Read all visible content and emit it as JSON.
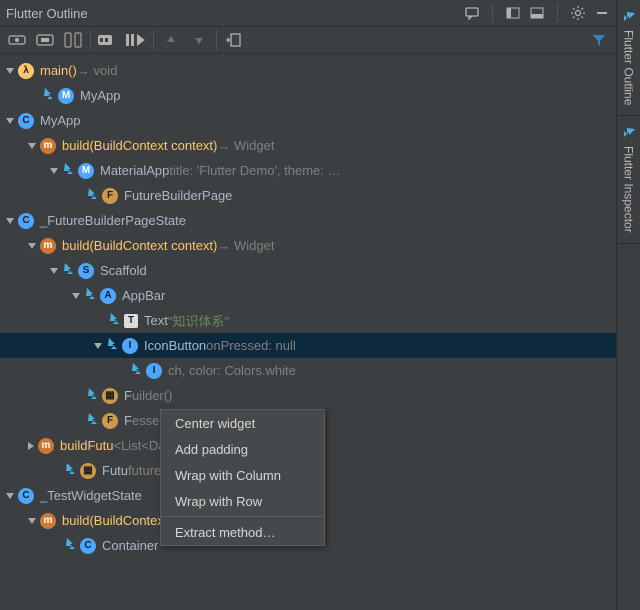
{
  "header": {
    "title": "Flutter Outline"
  },
  "sideTabs": {
    "outline": "Flutter Outline",
    "inspector": "Flutter Inspector"
  },
  "tree": [
    {
      "indent": 0,
      "arrow": "down",
      "flutter": false,
      "badge": "lam",
      "badgeText": "λ",
      "text": "main()",
      "suffix": " → void"
    },
    {
      "indent": 1,
      "arrow": "none",
      "flutter": true,
      "badge": "M",
      "badgeText": "M",
      "text": "MyApp"
    },
    {
      "indent": 0,
      "arrow": "down",
      "flutter": false,
      "badge": "c",
      "badgeText": "C",
      "text": "MyApp"
    },
    {
      "indent": 1,
      "arrow": "down",
      "flutter": false,
      "badge": "m",
      "badgeText": "m",
      "text": "build(BuildContext context)",
      "suffix": " → Widget"
    },
    {
      "indent": 2,
      "arrow": "down",
      "flutter": true,
      "badge": "M",
      "badgeText": "M",
      "text": "MaterialApp",
      "detail": " title: 'Flutter Demo', theme: …"
    },
    {
      "indent": 3,
      "arrow": "none",
      "flutter": true,
      "badge": "f",
      "badgeText": "F",
      "text": "FutureBuilderPage"
    },
    {
      "indent": 0,
      "arrow": "down",
      "flutter": false,
      "badge": "c",
      "badgeText": "C",
      "text": "_FutureBuilderPageState"
    },
    {
      "indent": 1,
      "arrow": "down",
      "flutter": false,
      "badge": "m",
      "badgeText": "m",
      "text": "build(BuildContext context)",
      "suffix": " → Widget"
    },
    {
      "indent": 2,
      "arrow": "down",
      "flutter": true,
      "badge": "s",
      "badgeText": "S",
      "text": "Scaffold"
    },
    {
      "indent": 3,
      "arrow": "down",
      "flutter": true,
      "badge": "a",
      "badgeText": "A",
      "text": "AppBar"
    },
    {
      "indent": 4,
      "arrow": "none",
      "flutter": true,
      "badge": "t",
      "badgeText": "T",
      "text": "Text",
      "string": " \"知识体系\""
    },
    {
      "indent": 4,
      "arrow": "down",
      "flutter": true,
      "badge": "c",
      "badgeText": "I",
      "text": "IconButton",
      "detail": " onPressed: null",
      "selected": true
    },
    {
      "indent": 5,
      "arrow": "none",
      "flutter": true,
      "badge": "c",
      "badgeText": "I",
      "text": "",
      "detail": "ch, color: Colors.white",
      "partial": true
    },
    {
      "indent": 3,
      "arrow": "none",
      "flutter": true,
      "badge": "struct",
      "badgeText": "▦",
      "text": "F",
      "detail": "uilder()",
      "partial": true
    },
    {
      "indent": 3,
      "arrow": "none",
      "flutter": true,
      "badge": "f",
      "badgeText": "F",
      "text": "F",
      "detail": "essed: () { … }",
      "partial": true
    },
    {
      "indent": 1,
      "arrow": "right",
      "flutter": false,
      "badge": "m",
      "badgeText": "m",
      "text": "buildFutu",
      "detail": "<List<Data>>",
      "partial": true
    },
    {
      "indent": 2,
      "arrow": "none",
      "flutter": true,
      "badge": "struct",
      "badgeText": "▦",
      "text": "Futu",
      "detail": "future: future",
      "partial": true
    },
    {
      "indent": 0,
      "arrow": "down",
      "flutter": false,
      "badge": "c",
      "badgeText": "C",
      "text": "_TestWidgetState"
    },
    {
      "indent": 1,
      "arrow": "down",
      "flutter": false,
      "badge": "m",
      "badgeText": "m",
      "text": "build(BuildContext context)",
      "suffix": " → Widget"
    },
    {
      "indent": 2,
      "arrow": "none",
      "flutter": true,
      "badge": "c",
      "badgeText": "C",
      "text": "Container"
    }
  ],
  "contextMenu": {
    "items": [
      "Center widget",
      "Add padding",
      "Wrap with Column",
      "Wrap with Row"
    ],
    "after": [
      "Extract method…"
    ]
  }
}
